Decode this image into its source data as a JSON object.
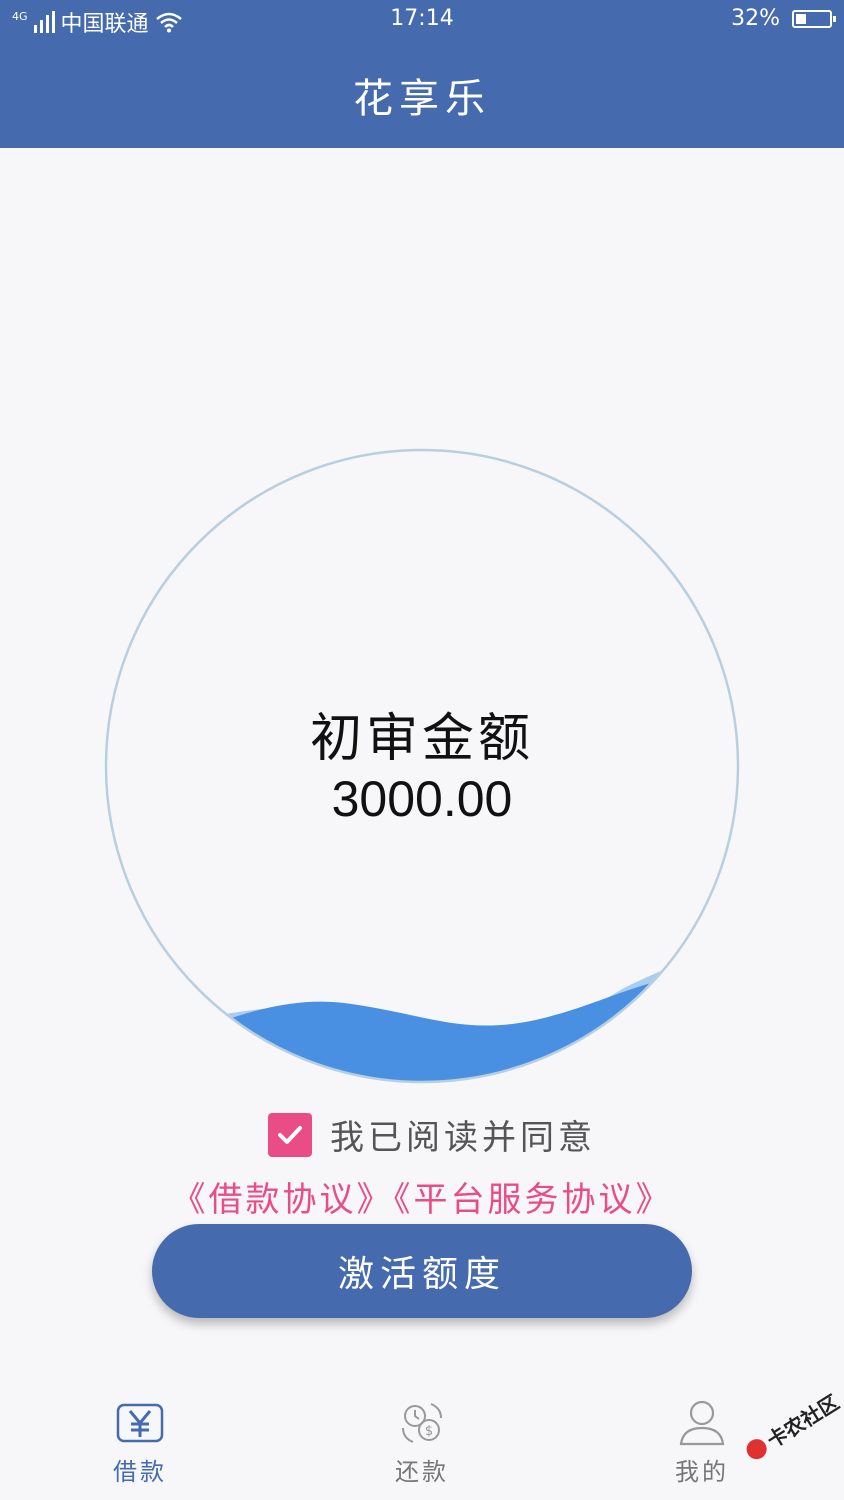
{
  "status_bar": {
    "network": "4G",
    "carrier": "中国联通",
    "time": "17:14",
    "battery": "32%"
  },
  "header": {
    "title": "花享乐"
  },
  "quota": {
    "label": "初审金额",
    "amount": "3000.00"
  },
  "agreement": {
    "checked": true,
    "text": "我已阅读并同意",
    "links": [
      "《借款协议》",
      "《平台服务协议》"
    ]
  },
  "activate_button": {
    "label": "激活额度"
  },
  "tabs": [
    {
      "label": "借款",
      "icon": "yen-icon",
      "active": true
    },
    {
      "label": "还款",
      "icon": "repay-icon",
      "active": false
    },
    {
      "label": "我的",
      "icon": "user-icon",
      "active": false
    }
  ],
  "watermark": {
    "text": "卡农社区"
  },
  "colors": {
    "primary": "#456aad",
    "accent": "#ea4d86",
    "wave": "#4a90e2",
    "wave_light": "#a9cdf0"
  }
}
